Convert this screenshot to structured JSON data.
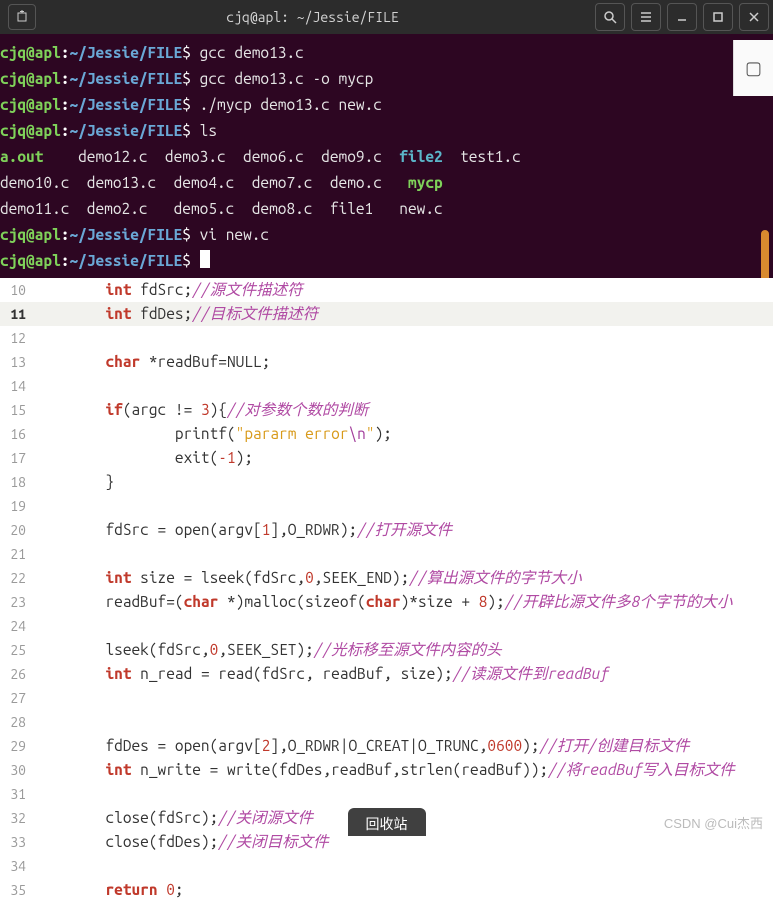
{
  "titlebar": {
    "title": "cjq@apl: ~/Jessie/FILE"
  },
  "prompt": {
    "user": "cjq@apl",
    "colon": ":",
    "path": "~/Jessie/FILE",
    "dollar": "$"
  },
  "term": {
    "cmd1": " gcc demo13.c",
    "cmd2": " gcc demo13.c -o mycp",
    "cmd3": " ./mycp demo13.c new.c",
    "cmd4": " ls",
    "ls_r1_a": "a.out    ",
    "ls_r1_b": "demo12.c  demo3.c  demo6.c  demo9.c  ",
    "ls_r1_file2": "file2",
    "ls_r1_c": "  test1.c",
    "ls_r2_a": "demo10.c  demo13.c  demo4.c  demo7.c  demo.c   ",
    "ls_r2_mycp": "mycp",
    "ls_r3": "demo11.c  demo2.c   demo5.c  demo8.c  file1   new.c",
    "cmd5": " vi new.c",
    "cmd6": " "
  },
  "editor": {
    "lines": {
      "10": {
        "ind": "        ",
        "t": [
          [
            "kw",
            "int"
          ],
          [
            "",
            ", fdSrc;"
          ],
          [
            "cmt",
            "//源文件描述符"
          ]
        ]
      },
      "11": {
        "ind": "        ",
        "t": [
          [
            "kw",
            "int"
          ],
          [
            "",
            " fdDes;"
          ],
          [
            "cmt",
            "//目标文件描述符"
          ]
        ]
      },
      "12": {
        "ind": "",
        "t": []
      },
      "13": {
        "ind": "        ",
        "t": [
          [
            "kw",
            "char"
          ],
          [
            "",
            " *readBuf=NULL;"
          ]
        ]
      },
      "14": {
        "ind": "",
        "t": []
      },
      "15": {
        "ind": "        ",
        "t": [
          [
            "kw",
            "if"
          ],
          [
            "",
            "(argc != "
          ],
          [
            "num",
            "3"
          ],
          [
            "",
            "){"
          ],
          [
            "cmt",
            "//对参数个数的判断"
          ]
        ]
      },
      "16": {
        "ind": "                ",
        "t": [
          [
            "",
            "printf("
          ],
          [
            "str",
            "\"pararm error"
          ],
          [
            "esc",
            "\\n"
          ],
          [
            "str",
            "\""
          ],
          [
            "",
            ");"
          ]
        ]
      },
      "17": {
        "ind": "                ",
        "t": [
          [
            "",
            "exit("
          ],
          [
            "num",
            "-1"
          ],
          [
            "",
            ");"
          ]
        ]
      },
      "18": {
        "ind": "        ",
        "t": [
          [
            "",
            "}"
          ]
        ]
      },
      "19": {
        "ind": "",
        "t": []
      },
      "20": {
        "ind": "        ",
        "t": [
          [
            "",
            "fdSrc = open(argv["
          ],
          [
            "num",
            "1"
          ],
          [
            "",
            "],O_RDWR);"
          ],
          [
            "cmt",
            "//打开源文件"
          ]
        ]
      },
      "21": {
        "ind": "",
        "t": []
      },
      "22": {
        "ind": "        ",
        "t": [
          [
            "kw",
            "int"
          ],
          [
            "",
            " size = lseek(fdSrc,"
          ],
          [
            "num",
            "0"
          ],
          [
            "",
            ",SEEK_END);"
          ],
          [
            "cmt",
            "//算出源文件的字节大小"
          ]
        ]
      },
      "23": {
        "ind": "        ",
        "t": [
          [
            "",
            "readBuf=("
          ],
          [
            "kw",
            "char"
          ],
          [
            "",
            " *)malloc(sizeof("
          ],
          [
            "kw",
            "char"
          ],
          [
            "",
            ")*size + "
          ],
          [
            "num",
            "8"
          ],
          [
            "",
            ");"
          ],
          [
            "cmt",
            "//开辟比源文件多8个字节的大小"
          ]
        ]
      },
      "24": {
        "ind": "",
        "t": []
      },
      "25": {
        "ind": "        ",
        "t": [
          [
            "",
            "lseek(fdSrc,"
          ],
          [
            "num",
            "0"
          ],
          [
            "",
            ",SEEK_SET);"
          ],
          [
            "cmt",
            "//光标移至源文件内容的头"
          ]
        ]
      },
      "26": {
        "ind": "        ",
        "t": [
          [
            "kw",
            "int"
          ],
          [
            "",
            " n_read = read(fdSrc, readBuf, size);"
          ],
          [
            "cmt",
            "//读源文件到readBuf"
          ]
        ]
      },
      "27": {
        "ind": "",
        "t": []
      },
      "28": {
        "ind": "",
        "t": []
      },
      "29": {
        "ind": "        ",
        "t": [
          [
            "",
            "fdDes = open(argv["
          ],
          [
            "num",
            "2"
          ],
          [
            "",
            "],O_RDWR|O_CREAT|O_TRUNC,"
          ],
          [
            "num",
            "0600"
          ],
          [
            "",
            ");"
          ],
          [
            "cmt",
            "//打开/创建目标文件"
          ]
        ]
      },
      "30": {
        "ind": "        ",
        "t": [
          [
            "kw",
            "int"
          ],
          [
            "",
            " n_write = write(fdDes,readBuf,strlen(readBuf));"
          ],
          [
            "cmt",
            "//将readBuf写入目标文件"
          ]
        ]
      },
      "31": {
        "ind": "",
        "t": []
      },
      "32": {
        "ind": "        ",
        "t": [
          [
            "",
            "close(fdSrc);"
          ],
          [
            "cmt",
            "//关闭源文件"
          ]
        ]
      },
      "33": {
        "ind": "        ",
        "t": [
          [
            "",
            "close(fdDes);"
          ],
          [
            "cmt",
            "//关闭目标文件"
          ]
        ]
      },
      "34": {
        "ind": "",
        "t": []
      },
      "35": {
        "ind": "        ",
        "t": [
          [
            "kw",
            "return"
          ],
          [
            "",
            " "
          ],
          [
            "num",
            "0"
          ],
          [
            "",
            ";"
          ]
        ]
      }
    },
    "current_line": "11"
  },
  "footer": {
    "pill": "回收站",
    "watermark": "CSDN @Cui杰西"
  }
}
